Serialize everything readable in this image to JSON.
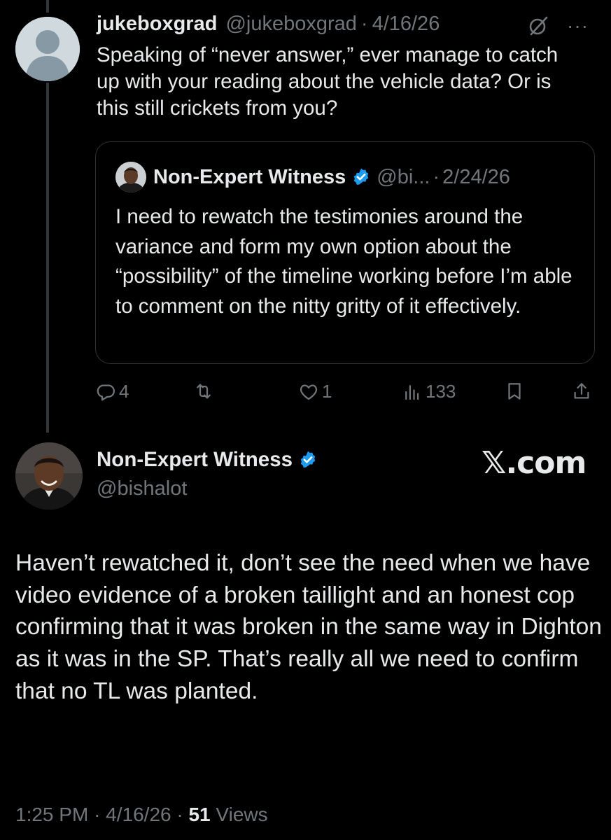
{
  "reply": {
    "name": "jukeboxgrad",
    "handle": "@jukeboxgrad",
    "separator": "·",
    "date": "4/16/26",
    "more": "···",
    "text": "Speaking of “never answer,” ever manage to catch up with your reading about the vehicle data? Or is this still crickets from you?",
    "actions": {
      "replies": "4",
      "likes": "1",
      "views": "133"
    }
  },
  "quote": {
    "name": "Non-Expert Witness",
    "handle": "@bi...",
    "separator": "·",
    "date": "2/24/26",
    "text": "I need to rewatch the testimonies around the variance and form my own option about the “possibility” of the timeline working before I’m able to comment on the nitty gritty of it effectively."
  },
  "main": {
    "name": "Non-Expert Witness",
    "handle": "@bishalot",
    "logo": "𝕏.com",
    "text": "Haven’t rewatched it, don’t see the need when we have video evidence of a broken taillight and an honest cop confirming that it was broken in the same way in Dighton as it was in the SP. That’s really all we need to confirm that no TL was planted.",
    "time": "1:25 PM",
    "separator": "·",
    "date": "4/16/26",
    "views_count": "51",
    "views_label": "Views"
  },
  "colors": {
    "background": "#000000",
    "text": "#e7e9ea",
    "muted": "#71767b",
    "verified": "#1d9bf0",
    "border": "#2f3336"
  }
}
